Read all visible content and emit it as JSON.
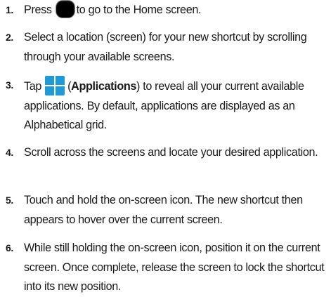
{
  "steps": [
    {
      "number": "1.",
      "before": "Press",
      "icon": "home-button-icon",
      "after": "to go to the Home screen."
    },
    {
      "number": "2.",
      "text": "Select a location (screen) for your new shortcut by scrolling through your available screens."
    },
    {
      "number": "3.",
      "before": "Tap",
      "icon": "applications-icon",
      "paren_open": "(",
      "bold": "Applications",
      "after": ") to reveal all your current available applications. By default, applications are displayed as an Alphabetical grid."
    },
    {
      "number": "4.",
      "text": "Scroll across the screens and locate your desired application."
    },
    {
      "number": "5.",
      "text": "Touch and hold the on-screen icon. The new shortcut then appears to hover over the current screen."
    },
    {
      "number": "6.",
      "text": "While still holding the on-screen icon, position it on the current screen. Once complete, release the screen to lock the shortcut into its new position."
    }
  ],
  "colors": {
    "applications_icon": "#1e9ad6",
    "home_button": "#000000"
  }
}
